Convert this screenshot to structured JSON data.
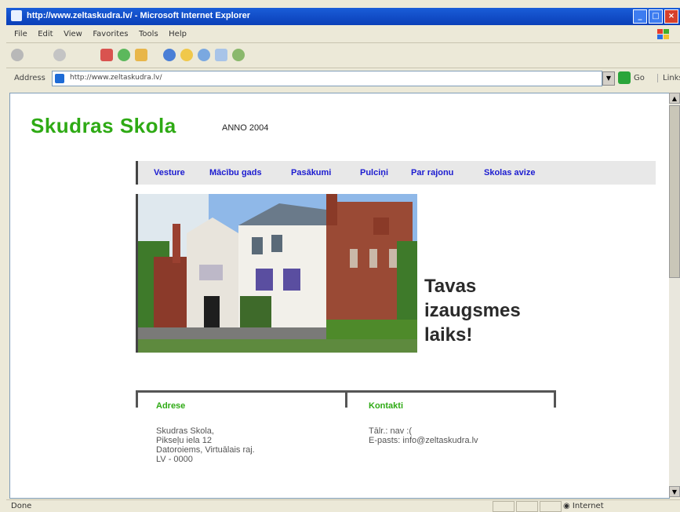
{
  "window": {
    "title": "http://www.zeltaskudra.lv/ - Microsoft Internet Explorer",
    "buttons": [
      "_",
      "□",
      "×"
    ]
  },
  "menu": [
    "File",
    "Edit",
    "View",
    "Favorites",
    "Tools",
    "Help"
  ],
  "address": {
    "label": "Address",
    "url": "http://www.zeltaskudra.lv/",
    "go_label": "Go",
    "links_label": "Links"
  },
  "status": {
    "text": "Done",
    "zone": "Internet"
  },
  "site": {
    "title": "Skudras Skola",
    "anno": "ANNO 2004",
    "nav": [
      "Vesture",
      "Mācību gads",
      "Pasākumi",
      "Pulciņi",
      "Par rajonu",
      "Skolas avize"
    ],
    "slogan": [
      "Tavas",
      "izaugsmes",
      "laiks!"
    ],
    "address_heading": "Adrese",
    "address_lines": [
      "Skudras Skola,",
      "Pikseļu iela 12",
      "Datoroiems, Virtuālais raj.",
      "LV - 0000"
    ],
    "contacts_heading": "Kontakti",
    "contacts_lines": [
      "Tālr.: nav :(",
      "E-pasts: info@zeltaskudra.lv"
    ]
  },
  "colors": {
    "title_green": "#2eaa14",
    "nav_blue": "#1c1cd0",
    "xp_blue": "#0a3fb8"
  },
  "icons": [
    "ie-page-icon",
    "back-icon",
    "forward-icon",
    "stop-icon",
    "refresh-icon",
    "home-icon",
    "search-icon",
    "favorites-icon",
    "media-icon",
    "mail-icon",
    "print-icon",
    "go-arrow-icon",
    "xp-logo-icon",
    "internet-zone-icon"
  ]
}
